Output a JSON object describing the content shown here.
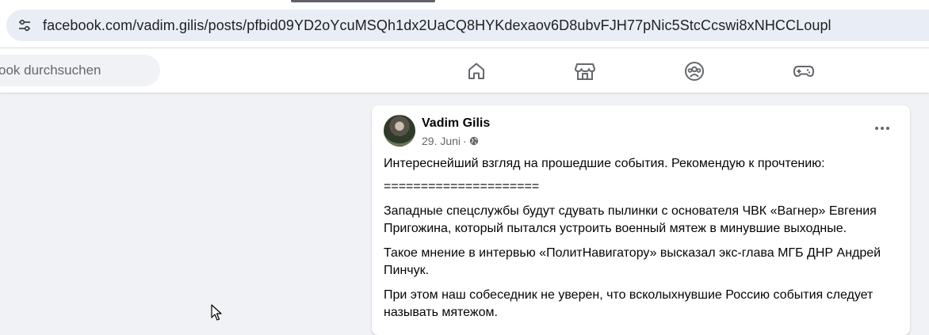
{
  "browser": {
    "url": "facebook.com/vadim.gilis/posts/pfbid09YD2oYcuMSQh1dx2UaCQ8HYKdexaov6D8ubvFJH77pNic5StcCcswi8xNHCCLoupl",
    "site_info_icon": "tune-icon"
  },
  "header": {
    "search_placeholder": "ook durchsuchen",
    "nav_icons": [
      "home-icon",
      "marketplace-icon",
      "groups-icon",
      "gaming-icon"
    ]
  },
  "post": {
    "author": "Vadim Gilis",
    "date": "29. Juni",
    "separator": "·",
    "audience_icon": "globe-icon",
    "paragraphs": [
      "Интереснейший взгляд на прошедшие события. Рекомендую к прочтению:",
      "=====================",
      "Западные спецслужбы будут сдувать пылинки с основателя ЧВК «Вагнер» Евгения Пригожина, который пытался устроить военный мятеж в минувшие выходные.",
      "Такое мнение в интервью «ПолитНавигатору» высказал экс-глава МГБ ДНР Андрей Пинчук.",
      "При этом наш собеседник не уверен, что всколыхнувшие Россию события следует называть мятежом."
    ]
  },
  "colors": {
    "page_bg": "#f0f2f5",
    "card_bg": "#ffffff",
    "secondary_text": "#65676b",
    "omnibox_bg": "#e9eef6"
  }
}
